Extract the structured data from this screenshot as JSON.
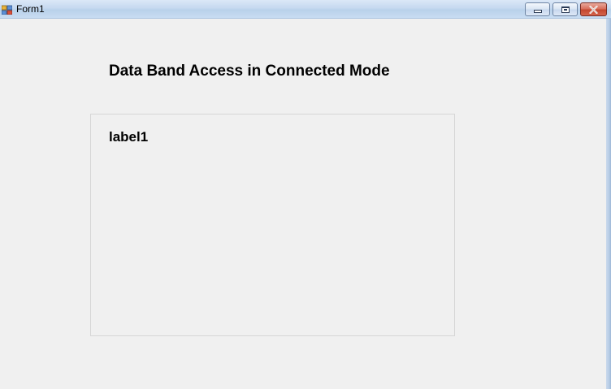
{
  "window": {
    "title": "Form1",
    "icon": "winforms-app-icon",
    "controls": {
      "minimize_icon": "minimize-icon",
      "maximize_icon": "maximize-icon",
      "close_glyph": "✕",
      "close_color": "#c4472f"
    }
  },
  "form": {
    "heading": "Data Band Access in Connected Mode",
    "panel": {
      "label": "label1"
    }
  }
}
